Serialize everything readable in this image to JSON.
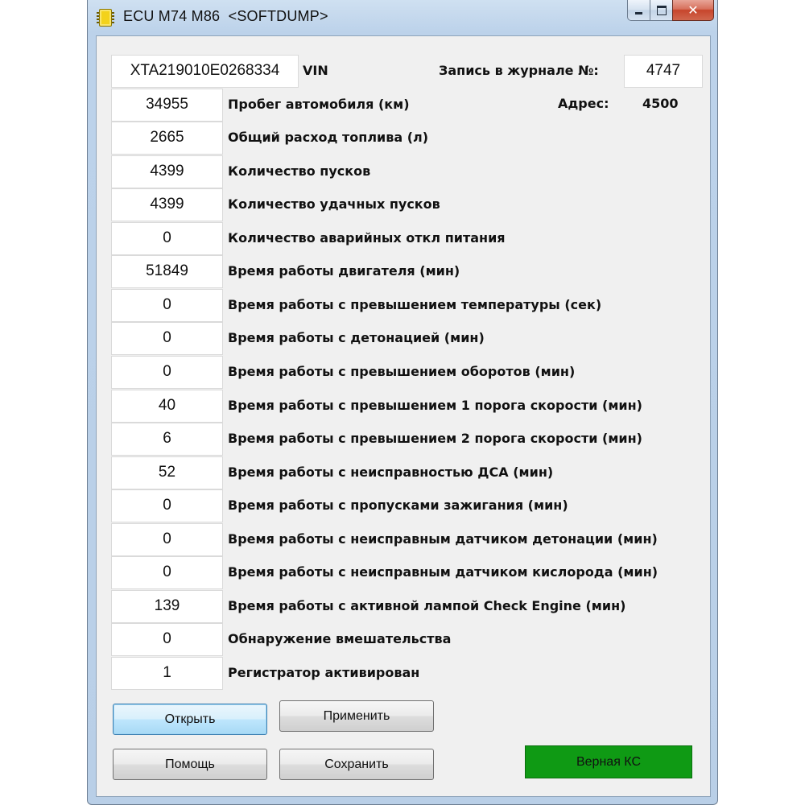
{
  "window": {
    "title": "ECU M74 M86  <SOFTDUMP>",
    "icon": "chip-icon"
  },
  "header": {
    "vin_value": "XTA219010E0268334",
    "vin_label": "VIN",
    "journal_label": "Запись в журнале №:",
    "journal_value": "4747",
    "address_label": "Адрес:",
    "address_value": "4500"
  },
  "rows": [
    {
      "value": "34955",
      "label": "Пробег автомобиля (км)"
    },
    {
      "value": "2665",
      "label": "Общий расход топлива (л)"
    },
    {
      "value": "4399",
      "label": "Количество пусков"
    },
    {
      "value": "4399",
      "label": "Количество удачных пусков"
    },
    {
      "value": "0",
      "label": "Количество аварийных откл питания"
    },
    {
      "value": "51849",
      "label": "Время работы двигателя (мин)"
    },
    {
      "value": "0",
      "label": "Время работы с превышением температуры (сек)"
    },
    {
      "value": "0",
      "label": "Время работы с детонацией (мин)"
    },
    {
      "value": "0",
      "label": "Время работы с превышением оборотов (мин)"
    },
    {
      "value": "40",
      "label": "Время работы с превышением 1 порога скорости (мин)"
    },
    {
      "value": "6",
      "label": "Время работы с превышением 2 порога скорости (мин)"
    },
    {
      "value": "52",
      "label": "Время работы с неисправностью ДСА (мин)"
    },
    {
      "value": "0",
      "label": "Время работы с пропусками зажигания (мин)"
    },
    {
      "value": "0",
      "label": "Время работы с неисправным датчиком детонации (мин)"
    },
    {
      "value": "0",
      "label": "Время работы с неисправным датчиком кислорода (мин)"
    },
    {
      "value": "139",
      "label": "Время работы с активной лампой Check Engine (мин)"
    },
    {
      "value": "0",
      "label": "Обнаружение вмешательства"
    },
    {
      "value": "1",
      "label": "Регистратор активирован"
    }
  ],
  "buttons": {
    "open": "Открыть",
    "apply": "Применить",
    "help": "Помощь",
    "save": "Сохранить"
  },
  "status": {
    "text": "Верная КС",
    "color": "#0f9a14"
  }
}
